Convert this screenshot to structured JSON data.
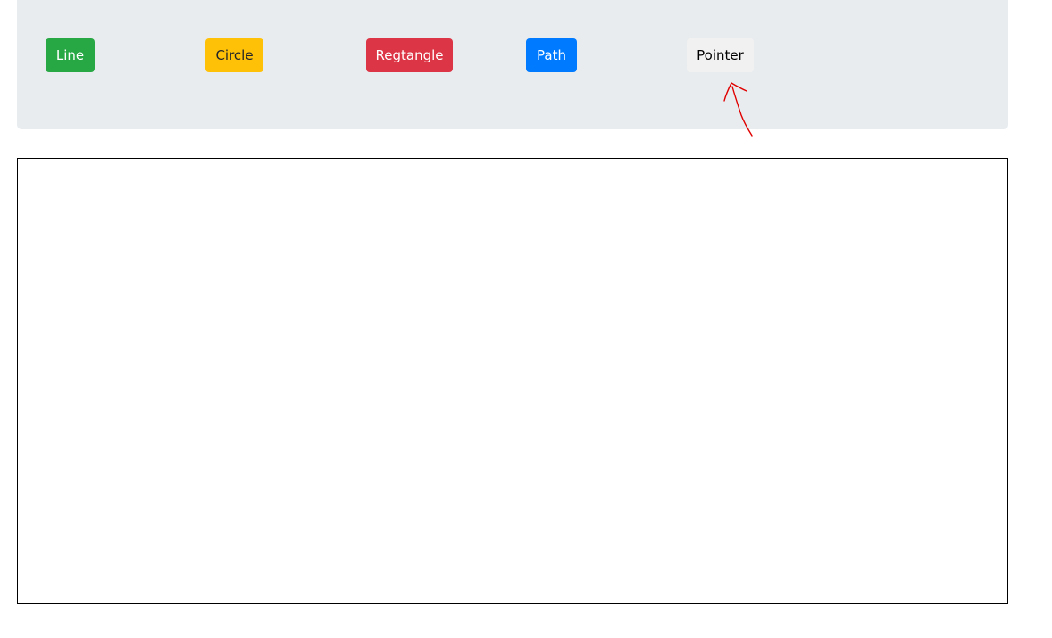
{
  "toolbar": {
    "line_label": "Line",
    "circle_label": "Circle",
    "rectangle_label": "Regtangle",
    "path_label": "Path",
    "pointer_label": "Pointer"
  },
  "colors": {
    "line_bg": "#28a745",
    "line_fg": "#ffffff",
    "circle_bg": "#ffc107",
    "circle_fg": "#212529",
    "rectangle_bg": "#dc3545",
    "rectangle_fg": "#ffffff",
    "path_bg": "#007bff",
    "path_fg": "#ffffff",
    "pointer_bg": "#f1f1f1",
    "pointer_fg": "#000000",
    "annotation": "#e00000"
  }
}
